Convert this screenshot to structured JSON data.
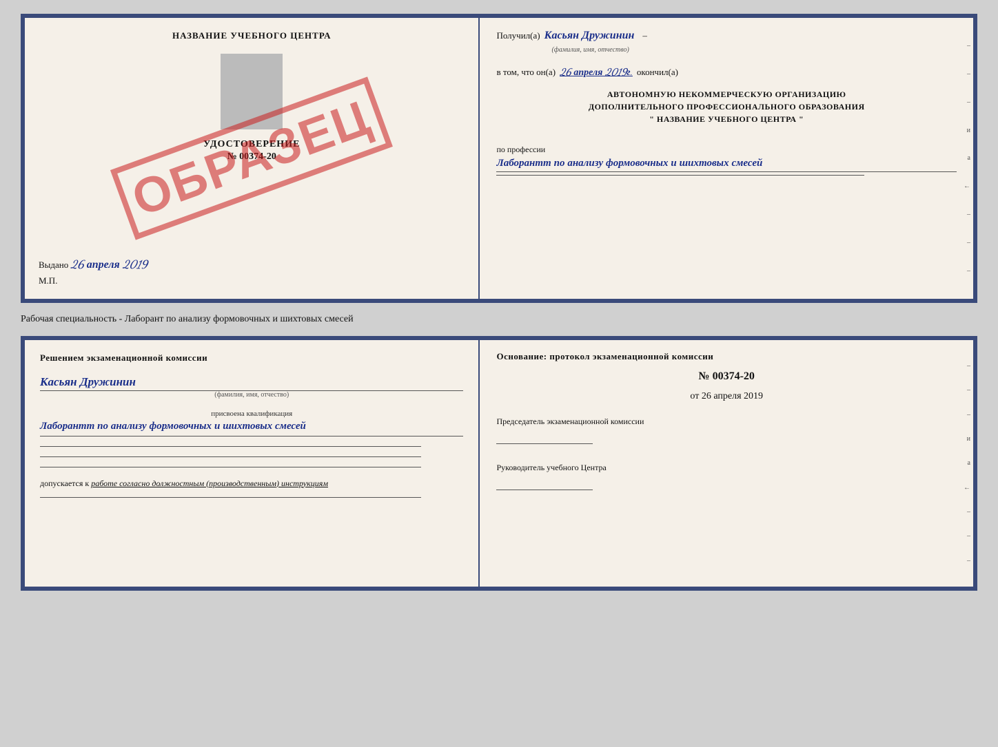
{
  "page": {
    "background": "#d0d0d0"
  },
  "topDoc": {
    "left": {
      "title": "НАЗВАНИЕ УЧЕБНОГО ЦЕНТРА",
      "stampText": "ОБРАЗЕЦ",
      "udostoverenie": "УДОСТОВЕРЕНИЕ",
      "nomer": "№ 00374-20",
      "vydano": "Выдано",
      "vydanoDate": "26 апреля 2019",
      "mp": "М.П."
    },
    "right": {
      "poluchilLabel": "Получил(а)",
      "poluchilName": "Касьян Дружинин",
      "familiyaLabel": "(фамилия, имя, отчество)",
      "vTomLabel": "в том, что он(а)",
      "date": "26 апреля 2019г.",
      "okonchilLabel": "окончил(а)",
      "formalLine1": "АВТОНОМНУЮ НЕКОММЕРЧЕСКУЮ ОРГАНИЗАЦИЮ",
      "formalLine2": "ДОПОЛНИТЕЛЬНОГО ПРОФЕССИОНАЛЬНОГО ОБРАЗОВАНИЯ",
      "formalLine3": "\"  НАЗВАНИЕ УЧЕБНОГО ЦЕНТРА  \"",
      "professionLabel": "по профессии",
      "professionText": "Лаборантт по анализу формовочных и шихтовых смесей"
    }
  },
  "caption": "Рабочая специальность - Лаборант по анализу формовочных и шихтовых смесей",
  "bottomDoc": {
    "left": {
      "header": "Решением  экзаменационной  комиссии",
      "name": "Касьян  Дружинин",
      "familiyaLabel": "(фамилия, имя, отчество)",
      "prisvoenaLabel": "присвоена квалификация",
      "qualification": "Лаборантт по анализу формовочных и шихтовых смесей",
      "dopuskaetsyaLabel": "допускается к",
      "dopuskaetsyaText": "работе согласно должностным (производственным) инструкциям"
    },
    "right": {
      "osnovanie": "Основание: протокол экзаменационной  комиссии",
      "protokolNomer": "№  00374-20",
      "otLabel": "от",
      "date": "26 апреля 2019",
      "predsedatelTitle": "Председатель экзаменационной комиссии",
      "rukovoditelTitle": "Руководитель учебного Центра"
    }
  },
  "marginChars": [
    "–",
    "–",
    "–",
    "и",
    "а",
    "←",
    "–",
    "–",
    "–"
  ]
}
